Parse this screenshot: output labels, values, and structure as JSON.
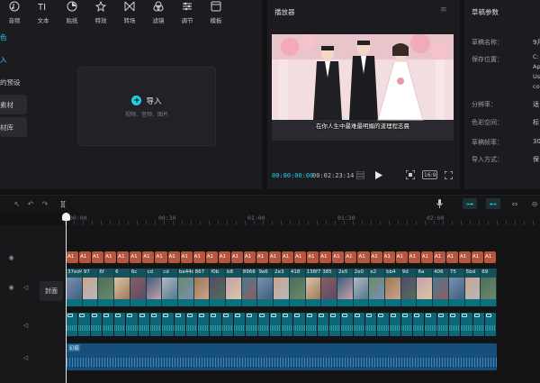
{
  "toolbar": {
    "items": [
      {
        "label": "音频",
        "icon": "audio-icon"
      },
      {
        "label": "文本",
        "icon": "text-icon"
      },
      {
        "label": "贴纸",
        "icon": "sticker-icon"
      },
      {
        "label": "特效",
        "icon": "effects-icon"
      },
      {
        "label": "转场",
        "icon": "transition-icon"
      },
      {
        "label": "滤镜",
        "icon": "filter-icon"
      },
      {
        "label": "调节",
        "icon": "adjust-icon"
      },
      {
        "label": "模板",
        "icon": "template-icon"
      }
    ]
  },
  "sidebar": {
    "items": [
      {
        "label": "色"
      },
      {
        "label": "入"
      },
      {
        "label": "的预设"
      },
      {
        "label": "素材"
      },
      {
        "label": "材库"
      }
    ]
  },
  "import": {
    "label": "导入",
    "hint": "视频、音频、图片"
  },
  "player": {
    "title": "播放器",
    "subtitle": "在你人生中最难最明媚的道理程志晨",
    "current_time": "00:00:00:00",
    "total_time": "00:02:23:14",
    "ratio_label": "16:9"
  },
  "draft": {
    "title": "草稿参数",
    "fields": [
      {
        "key": "草稿名称：",
        "value": "9月"
      },
      {
        "key": "保存位置：",
        "value": "C:\nAp\nUs\nco"
      },
      {
        "key": "分辨率：",
        "value": "适"
      },
      {
        "key": "色彩空间：",
        "value": "标"
      },
      {
        "key": "草稿帧率：",
        "value": "30"
      },
      {
        "key": "导入方式：",
        "value": "保"
      }
    ]
  },
  "timeline": {
    "ruler_labels": [
      "00:00",
      "00:30",
      "01:00",
      "01:30",
      "02:00"
    ],
    "cover_label": "封面",
    "text_clip_label": "A1",
    "text_clip_count": 34,
    "video_clip_labels": [
      "37ed4ea5",
      "97",
      "6f",
      "6",
      "6c",
      "cd",
      "cd",
      "be44d6",
      "867",
      "f0b",
      "b8",
      "8966",
      "9a6",
      "2e3",
      "418",
      "138f7",
      "385",
      "2e5",
      "2e0",
      "e2",
      "bb4",
      "9d",
      "6a",
      "406",
      "75",
      "5bd",
      "69"
    ],
    "audio_clip_count": 36,
    "music_label": "幻痕"
  },
  "colors": {
    "accent": "#22d3ee",
    "text_clip": "#b5573e",
    "video_track": "#17525b",
    "audio_clip": "#0c6676",
    "music_track": "#16507a"
  }
}
